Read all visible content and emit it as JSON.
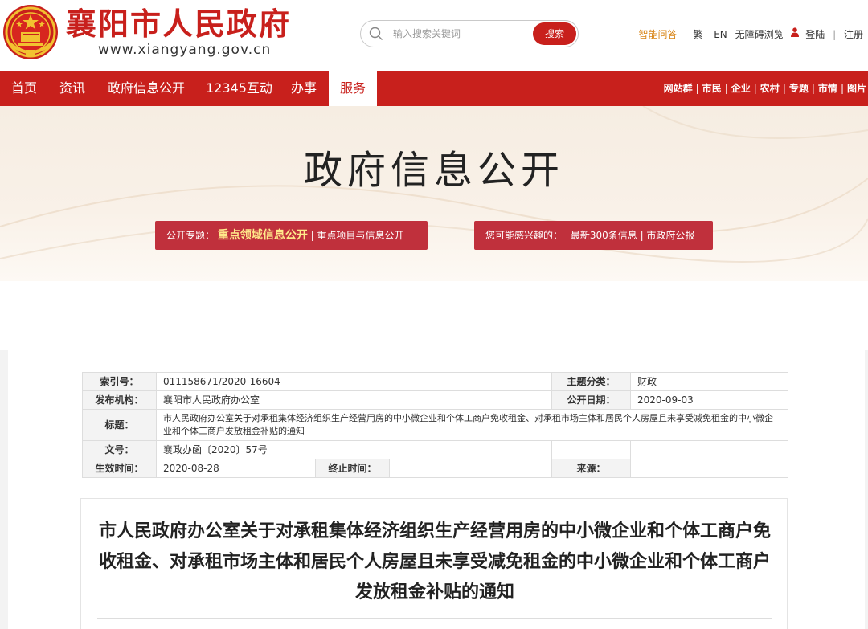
{
  "header": {
    "site_name": "襄阳市人民政府",
    "site_url": "www.xiangyang.gov.cn",
    "search_placeholder": "输入搜索关键词",
    "search_button": "搜索",
    "links": {
      "smart_qa": "智能问答",
      "traditional": "繁",
      "english": "EN",
      "accessibility": "无障碍浏览",
      "login": "登陆",
      "separator": "|",
      "register": "注册"
    }
  },
  "nav": {
    "items": [
      "首页",
      "资讯",
      "政府信息公开",
      "12345互动",
      "办事",
      "服务"
    ],
    "active_index": 5,
    "right_links": [
      "网站群",
      "市民",
      "企业",
      "农村",
      "专题",
      "市情",
      "图片"
    ]
  },
  "banner": {
    "title": "政府信息公开",
    "pill_left": {
      "prefix": "公开专题：",
      "highlight": "重点领域信息公开",
      "rest": "| 重点项目与信息公开"
    },
    "pill_right": {
      "prefix": "您可能感兴趣的：",
      "rest": "最新300条信息 | 市政府公报"
    }
  },
  "meta": {
    "index_label": "索引号：",
    "index_value": "011158671/2020-16604",
    "topic_label": "主题分类：",
    "topic_value": "财政",
    "issuer_label": "发布机构：",
    "issuer_value": "襄阳市人民政府办公室",
    "date_label": "公开日期：",
    "date_value": "2020-09-03",
    "title_label": "标题：",
    "title_value": "市人民政府办公室关于对承租集体经济组织生产经营用房的中小微企业和个体工商户免收租金、对承租市场主体和居民个人房屋且未享受减免租金的中小微企业和个体工商户发放租金补贴的通知",
    "docno_label": "文号：",
    "docno_value": "襄政办函〔2020〕57号",
    "effective_label": "生效时间：",
    "effective_value": "2020-08-28",
    "expire_label": "终止时间：",
    "expire_value": "",
    "source_label": "来源：",
    "source_value": ""
  },
  "article": {
    "title": "市人民政府办公室关于对承租集体经济组织生产经营用房的中小微企业和个体工商户免收租金、对承租市场主体和居民个人房屋且未享受减免租金的中小微企业和个体工商户发放租金补贴的通知"
  },
  "colors": {
    "brand_red": "#c8201c",
    "pill_red": "#c0303c",
    "gold": "#d88414"
  },
  "icons": [
    "national-emblem-icon",
    "search-icon",
    "user-icon"
  ]
}
